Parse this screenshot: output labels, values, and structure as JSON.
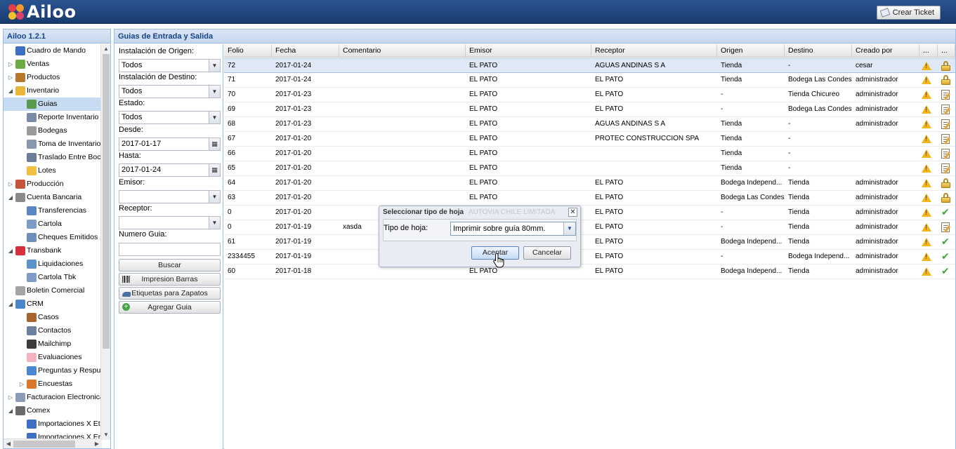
{
  "header": {
    "brand": "Ailoo",
    "crear_ticket_label": "Crear Ticket",
    "colors": {
      "bar": "#1f4a85",
      "accent": "#e63d4a"
    }
  },
  "sidebar": {
    "title": "Ailoo 1.2.1",
    "items": [
      {
        "label": "Cuadro de Mando",
        "icon": "chart-icon",
        "level": 0,
        "expander": ""
      },
      {
        "label": "Ventas",
        "icon": "tag-icon",
        "level": 0,
        "expander": "▷"
      },
      {
        "label": "Productos",
        "icon": "box-icon",
        "level": 0,
        "expander": "▷"
      },
      {
        "label": "Inventario",
        "icon": "package-icon",
        "level": 0,
        "expander": "◢"
      },
      {
        "label": "Guias",
        "icon": "guide-icon",
        "level": 1,
        "expander": "",
        "selected": true
      },
      {
        "label": "Reporte Inventario",
        "icon": "report-icon",
        "level": 1,
        "expander": ""
      },
      {
        "label": "Bodegas",
        "icon": "warehouse-icon",
        "level": 1,
        "expander": ""
      },
      {
        "label": "Toma de Inventario",
        "icon": "document-icon",
        "level": 1,
        "expander": ""
      },
      {
        "label": "Traslado Entre Boc",
        "icon": "truck-icon",
        "level": 1,
        "expander": ""
      },
      {
        "label": "Lotes",
        "icon": "cube-icon",
        "level": 1,
        "expander": ""
      },
      {
        "label": "Producción",
        "icon": "factory-icon",
        "level": 0,
        "expander": "▷"
      },
      {
        "label": "Cuenta Bancaria",
        "icon": "bank-icon",
        "level": 0,
        "expander": "◢"
      },
      {
        "label": "Transferencias",
        "icon": "transfer-icon",
        "level": 1,
        "expander": ""
      },
      {
        "label": "Cartola",
        "icon": "statement-icon",
        "level": 1,
        "expander": ""
      },
      {
        "label": "Cheques Emitidos",
        "icon": "check-book-icon",
        "level": 1,
        "expander": ""
      },
      {
        "label": "Transbank",
        "icon": "transbank-icon",
        "level": 0,
        "expander": "◢"
      },
      {
        "label": "Liquidaciones",
        "icon": "settlement-icon",
        "level": 1,
        "expander": ""
      },
      {
        "label": "Cartola Tbk",
        "icon": "statement-icon",
        "level": 1,
        "expander": ""
      },
      {
        "label": "Boletin Comercial",
        "icon": "bulletin-icon",
        "level": 0,
        "expander": ""
      },
      {
        "label": "CRM",
        "icon": "crm-icon",
        "level": 0,
        "expander": "◢"
      },
      {
        "label": "Casos",
        "icon": "briefcase-icon",
        "level": 1,
        "expander": ""
      },
      {
        "label": "Contactos",
        "icon": "contacts-icon",
        "level": 1,
        "expander": ""
      },
      {
        "label": "Mailchimp",
        "icon": "mailchimp-icon",
        "level": 1,
        "expander": ""
      },
      {
        "label": "Evaluaciones",
        "icon": "evaluation-icon",
        "level": 1,
        "expander": ""
      },
      {
        "label": "Preguntas y Respu",
        "icon": "question-icon",
        "level": 1,
        "expander": ""
      },
      {
        "label": "Encuestas",
        "icon": "survey-icon",
        "level": 1,
        "expander": "▷"
      },
      {
        "label": "Facturacion Electronica",
        "icon": "invoice-icon",
        "level": 0,
        "expander": "▷"
      },
      {
        "label": "Comex",
        "icon": "comex-icon",
        "level": 0,
        "expander": "◢"
      },
      {
        "label": "Importaciones X Et",
        "icon": "chart-icon",
        "level": 1,
        "expander": ""
      },
      {
        "label": "Importaciones X Er",
        "icon": "chart-icon",
        "level": 1,
        "expander": ""
      }
    ]
  },
  "main": {
    "title": "Guias de Entrada y Salida"
  },
  "filters": {
    "origen_label": "Instalación de Origen:",
    "origen_value": "Todos",
    "destino_label": "Instalación de Destino:",
    "destino_value": "Todos",
    "estado_label": "Estado:",
    "estado_value": "Todos",
    "desde_label": "Desde:",
    "desde_value": "2017-01-17",
    "hasta_label": "Hasta:",
    "hasta_value": "2017-01-24",
    "emisor_label": "Emisor:",
    "emisor_value": "",
    "receptor_label": "Receptor:",
    "receptor_value": "",
    "numero_label": "Numero Guia:",
    "numero_value": "",
    "buscar_label": "Buscar",
    "barras_label": "Impresion Barras",
    "zapatos_label": "Etiquetas para Zapatos",
    "agregar_label": "Agregar Guia"
  },
  "grid": {
    "columns": [
      "Folio",
      "Fecha",
      "Comentario",
      "Emisor",
      "Receptor",
      "Origen",
      "Destino",
      "Creado por",
      "...",
      "..."
    ],
    "rows": [
      {
        "folio": "72",
        "fecha": "2017-01-24",
        "comentario": "",
        "emisor": "EL PATO",
        "receptor": "AGUAS ANDINAS S A",
        "origen": "Tienda",
        "destino": "-",
        "creado": "cesar",
        "status": "lock",
        "selected": true
      },
      {
        "folio": "71",
        "fecha": "2017-01-24",
        "comentario": "",
        "emisor": "EL PATO",
        "receptor": "EL PATO",
        "origen": "Tienda",
        "destino": "Bodega Las Condes",
        "creado": "administrador",
        "status": "lock"
      },
      {
        "folio": "70",
        "fecha": "2017-01-23",
        "comentario": "",
        "emisor": "EL PATO",
        "receptor": "EL PATO",
        "origen": "-",
        "destino": "Tienda Chicureo",
        "creado": "administrador",
        "status": "edit"
      },
      {
        "folio": "69",
        "fecha": "2017-01-23",
        "comentario": "",
        "emisor": "EL PATO",
        "receptor": "EL PATO",
        "origen": "-",
        "destino": "Bodega Las Condes",
        "creado": "administrador",
        "status": "edit"
      },
      {
        "folio": "68",
        "fecha": "2017-01-23",
        "comentario": "",
        "emisor": "EL PATO",
        "receptor": "AGUAS ANDINAS S A",
        "origen": "Tienda",
        "destino": "-",
        "creado": "administrador",
        "status": "edit"
      },
      {
        "folio": "67",
        "fecha": "2017-01-20",
        "comentario": "",
        "emisor": "EL PATO",
        "receptor": "PROTEC CONSTRUCCION SPA",
        "origen": "Tienda",
        "destino": "-",
        "creado": "",
        "status": "edit"
      },
      {
        "folio": "66",
        "fecha": "2017-01-20",
        "comentario": "",
        "emisor": "EL PATO",
        "receptor": "",
        "origen": "Tienda",
        "destino": "-",
        "creado": "",
        "status": "edit"
      },
      {
        "folio": "65",
        "fecha": "2017-01-20",
        "comentario": "",
        "emisor": "EL PATO",
        "receptor": "",
        "origen": "Tienda",
        "destino": "-",
        "creado": "",
        "status": "edit"
      },
      {
        "folio": "64",
        "fecha": "2017-01-20",
        "comentario": "",
        "emisor": "EL PATO",
        "receptor": "EL PATO",
        "origen": "Bodega Independ...",
        "destino": "Tienda",
        "creado": "administrador",
        "status": "lock"
      },
      {
        "folio": "63",
        "fecha": "2017-01-20",
        "comentario": "",
        "emisor": "EL PATO",
        "receptor": "EL PATO",
        "origen": "Bodega Las Condes",
        "destino": "Tienda",
        "creado": "administrador",
        "status": "lock"
      },
      {
        "folio": "0",
        "fecha": "2017-01-20",
        "comentario": "",
        "emisor": "",
        "receptor": "EL PATO",
        "origen": "-",
        "destino": "Tienda",
        "creado": "administrador",
        "status": "check"
      },
      {
        "folio": "0",
        "fecha": "2017-01-19",
        "comentario": "xasda",
        "emisor": "",
        "receptor": "EL PATO",
        "origen": "-",
        "destino": "Tienda",
        "creado": "administrador",
        "status": "edit"
      },
      {
        "folio": "61",
        "fecha": "2017-01-19",
        "comentario": "",
        "emisor": "",
        "receptor": "EL PATO",
        "origen": "Bodega Independ...",
        "destino": "Tienda",
        "creado": "administrador",
        "status": "check"
      },
      {
        "folio": "2334455",
        "fecha": "2017-01-19",
        "comentario": "",
        "emisor": "",
        "receptor": "EL PATO",
        "origen": "-",
        "destino": "Bodega Independ...",
        "creado": "administrador",
        "status": "check"
      },
      {
        "folio": "60",
        "fecha": "2017-01-18",
        "comentario": "",
        "emisor": "EL PATO",
        "receptor": "EL PATO",
        "origen": "Bodega Independ...",
        "destino": "Tienda",
        "creado": "administrador",
        "status": "check"
      }
    ]
  },
  "dialog": {
    "title": "Seleccionar tipo de hoja",
    "title_ghost": "AUTOVIA CHILE LIMITADA",
    "field_label": "Tipo de hoja:",
    "field_value": "Imprimir sobre guía 80mm.",
    "accept_label": "Aceptar",
    "cancel_label": "Cancelar"
  }
}
